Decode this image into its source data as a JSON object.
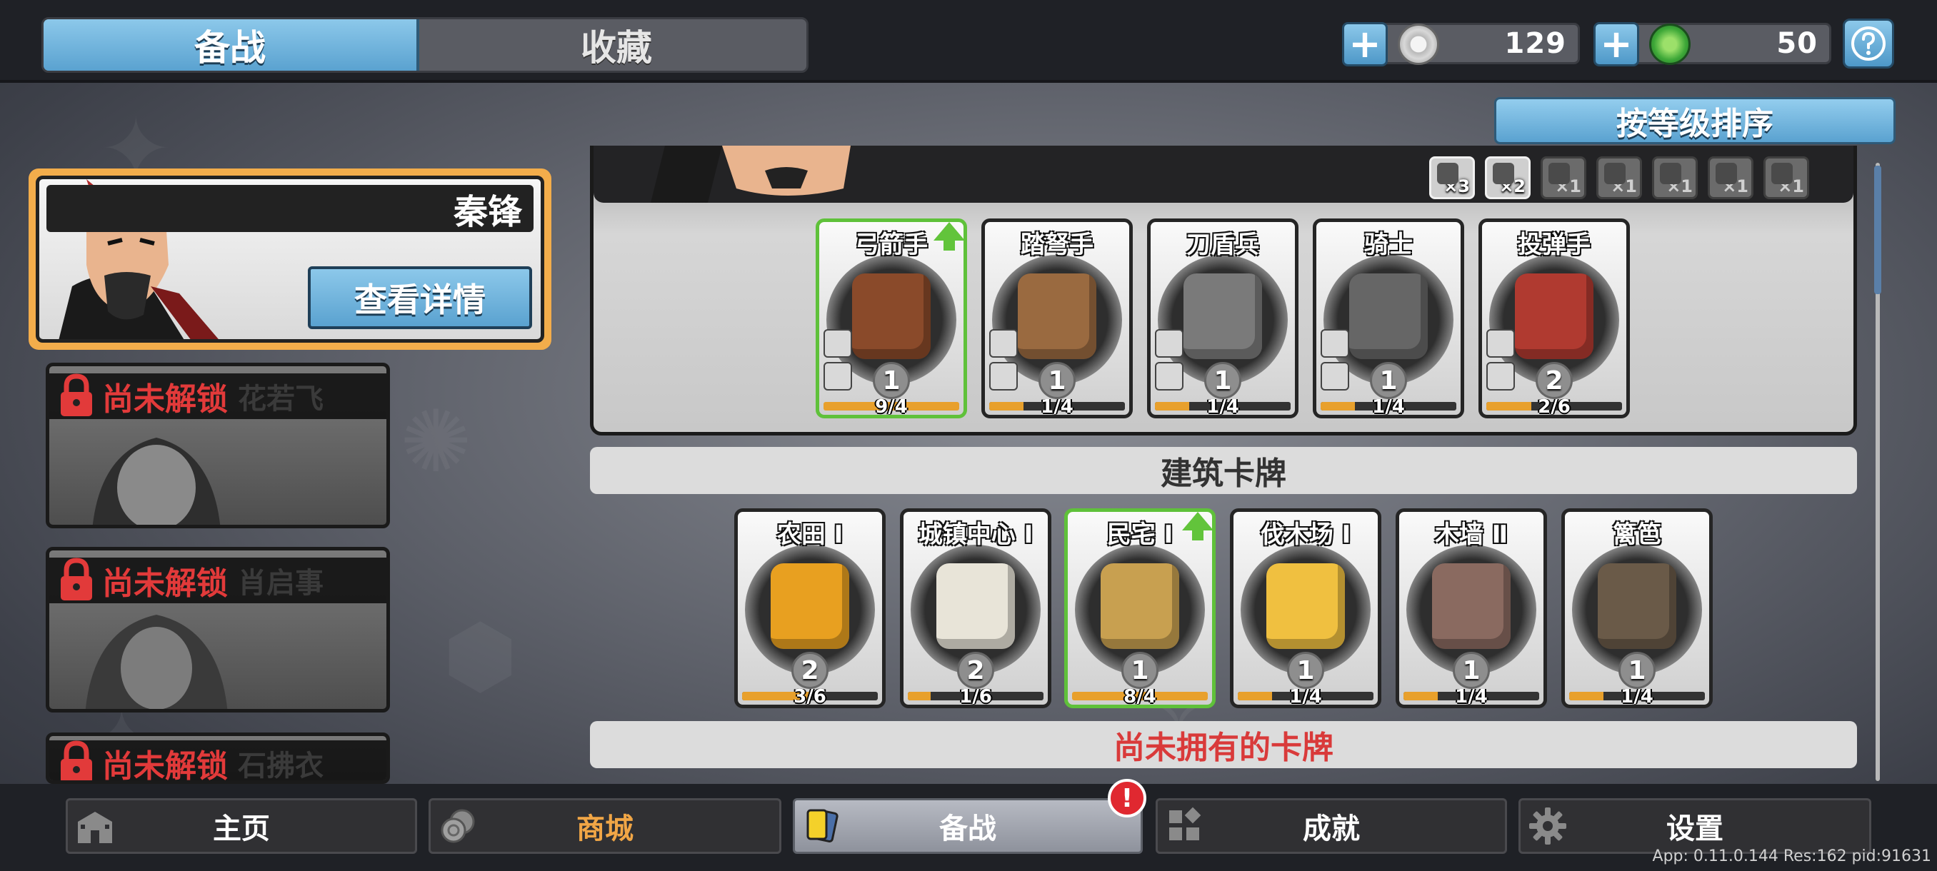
{
  "tabs": {
    "active": "备战",
    "inactive": "收藏"
  },
  "currencies": [
    {
      "icon": "silver-coin-icon",
      "value": "129"
    },
    {
      "icon": "jade-coin-icon",
      "value": "50"
    }
  ],
  "sort_label": "按等级排序",
  "commanders": {
    "selected": {
      "name": "秦锋",
      "detail_button": "查看详情"
    },
    "locked": [
      {
        "status": "尚未解锁",
        "name": "花若飞"
      },
      {
        "status": "尚未解锁",
        "name": "肖启事"
      },
      {
        "status": "尚未解锁",
        "name": "石拂衣"
      }
    ]
  },
  "unit_type_badges": [
    {
      "icon": "bow-icon",
      "count": "×3",
      "active": true
    },
    {
      "icon": "helmet-icon",
      "count": "×2",
      "active": true
    },
    {
      "icon": "fist-icon",
      "count": "×1",
      "active": false
    },
    {
      "icon": "sword-icon",
      "count": "×1",
      "active": false
    },
    {
      "icon": "shield-icon",
      "count": "×1",
      "active": false
    },
    {
      "icon": "skull-icon",
      "count": "×1",
      "active": false
    },
    {
      "icon": "catapult-icon",
      "count": "×1",
      "active": false
    }
  ],
  "unit_cards": [
    {
      "name": "弓箭手",
      "level": "1",
      "progress": "9/4",
      "fill": 1.0,
      "upgradable": true,
      "color": "#8a4a2a"
    },
    {
      "name": "踏弩手",
      "level": "1",
      "progress": "1/4",
      "fill": 0.25,
      "upgradable": false,
      "color": "#9a6a40"
    },
    {
      "name": "刀盾兵",
      "level": "1",
      "progress": "1/4",
      "fill": 0.25,
      "upgradable": false,
      "color": "#7a7a7a"
    },
    {
      "name": "骑士",
      "level": "1",
      "progress": "1/4",
      "fill": 0.25,
      "upgradable": false,
      "color": "#666666"
    },
    {
      "name": "投弹手",
      "level": "2",
      "progress": "2/6",
      "fill": 0.33,
      "upgradable": false,
      "color": "#b03a30"
    }
  ],
  "building_section_title": "建筑卡牌",
  "building_cards": [
    {
      "name": "农田 Ⅰ",
      "level": "2",
      "progress": "3/6",
      "fill": 0.5,
      "upgradable": false,
      "color": "#e8a020"
    },
    {
      "name": "城镇中心 Ⅰ",
      "level": "2",
      "progress": "1/6",
      "fill": 0.17,
      "upgradable": false,
      "color": "#e8e4d8"
    },
    {
      "name": "民宅 Ⅰ",
      "level": "1",
      "progress": "8/4",
      "fill": 1.0,
      "upgradable": true,
      "color": "#c8a050"
    },
    {
      "name": "伐木场 Ⅰ",
      "level": "1",
      "progress": "1/4",
      "fill": 0.25,
      "upgradable": false,
      "color": "#f0c040"
    },
    {
      "name": "木墙 Ⅱ",
      "level": "1",
      "progress": "1/4",
      "fill": 0.25,
      "upgradable": false,
      "color": "#8a6a60"
    },
    {
      "name": "篱笆",
      "level": "1",
      "progress": "1/4",
      "fill": 0.25,
      "upgradable": false,
      "color": "#6a5a48"
    }
  ],
  "unowned_section_title": "尚未拥有的卡牌",
  "bottom_nav": [
    {
      "label": "主页",
      "icon": "castle-icon",
      "highlight": false
    },
    {
      "label": "商城",
      "icon": "coins-icon",
      "highlight": true
    },
    {
      "label": "备战",
      "icon": "cards-icon",
      "active": true,
      "notification": "!"
    },
    {
      "label": "成就",
      "icon": "achievements-icon"
    },
    {
      "label": "设置",
      "icon": "gear-icon"
    }
  ],
  "version_text": "App: 0.11.0.144 Res:162 pid:91631",
  "colors": {
    "accent_blue": "#5aa2d0",
    "selected_gold": "#f3ad4b",
    "locked_red": "#e23a3a",
    "upgrade_green": "#5fc13a",
    "progress_orange": "#e8a02c"
  }
}
